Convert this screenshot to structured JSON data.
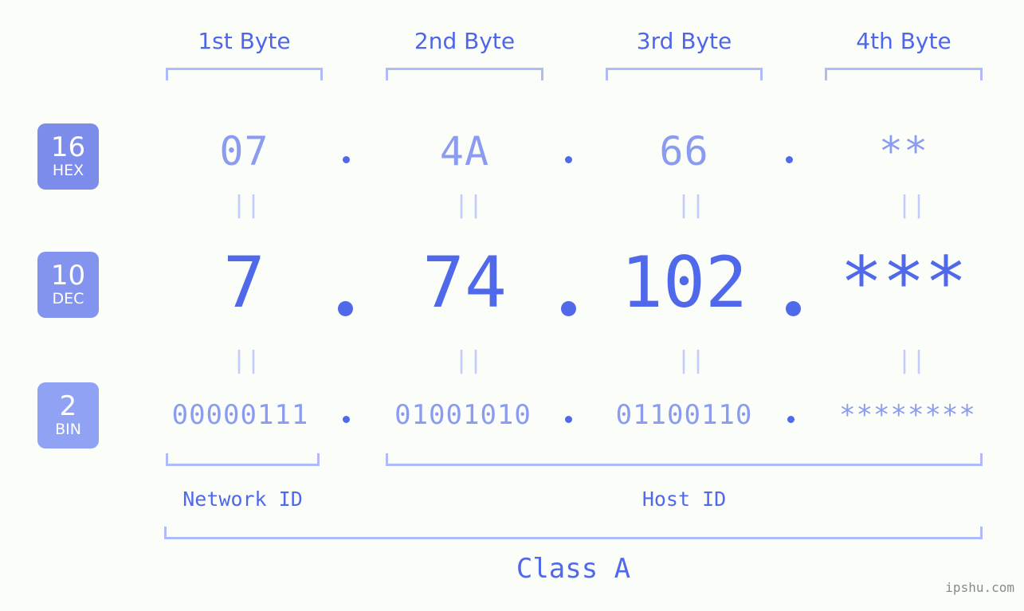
{
  "background_color": "#fbfdf9",
  "colors": {
    "accent_dark": "#5068ea",
    "accent_light": "#8b9cf0",
    "bracket": "#afbaf8",
    "eq_mark": "#c3cbfb",
    "badge_hex": "#7b8ceb",
    "badge_dec": "#8294ee",
    "badge_bin": "#8fa2f4",
    "watermark": "#8a8a8a"
  },
  "byte_headers": [
    {
      "label": "1st Byte"
    },
    {
      "label": "2nd Byte"
    },
    {
      "label": "3rd Byte"
    },
    {
      "label": "4th Byte"
    }
  ],
  "bases": [
    {
      "num": "16",
      "name": "HEX"
    },
    {
      "num": "10",
      "name": "DEC"
    },
    {
      "num": "2",
      "name": "BIN"
    }
  ],
  "rows": {
    "hex": {
      "base_num": "16",
      "base_name": "HEX",
      "values": [
        "07",
        "4A",
        "66",
        "**"
      ]
    },
    "dec": {
      "base_num": "10",
      "base_name": "DEC",
      "values": [
        "7",
        "74",
        "102",
        "***"
      ]
    },
    "bin": {
      "base_num": "2",
      "base_name": "BIN",
      "values": [
        "00000111",
        "01001010",
        "01100110",
        "********"
      ]
    }
  },
  "separators": {
    "dot": ".",
    "equals": "||"
  },
  "segments": {
    "network_id": "Network ID",
    "host_id": "Host ID",
    "class": "Class A"
  },
  "watermark": "ipshu.com"
}
